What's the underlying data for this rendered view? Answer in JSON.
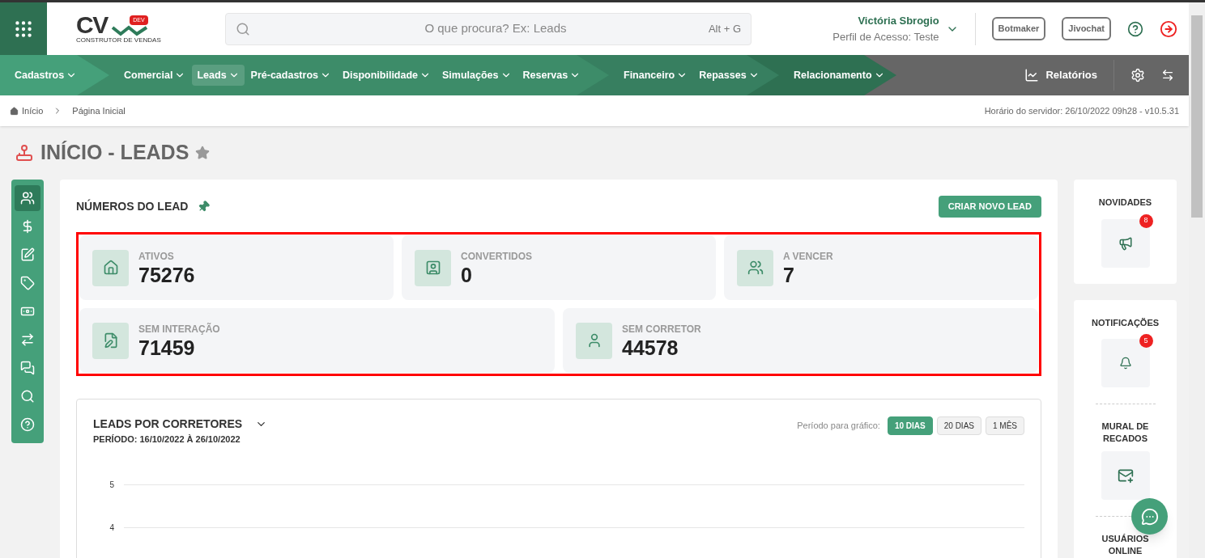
{
  "logo": {
    "letters": "CV",
    "badge": "DEV",
    "tagline": "CONSTRUTOR DE VENDAS"
  },
  "search": {
    "placeholder": "O que procura? Ex: Leads",
    "shortcut": "Alt + G"
  },
  "user": {
    "name": "Victória Sbrogio",
    "profile": "Perfil de Acesso: Teste"
  },
  "header_buttons": [
    "Botmaker",
    "Jivochat"
  ],
  "nav_groups": [
    {
      "color": "#45a07a",
      "items": [
        {
          "label": "Cadastros",
          "selected": false
        }
      ]
    },
    {
      "color": "#3d8c69",
      "items": [
        {
          "label": "Comercial",
          "selected": false
        },
        {
          "label": "Leads",
          "selected": true
        },
        {
          "label": "Pré-cadastros",
          "selected": false
        },
        {
          "label": "Disponibilidade",
          "selected": false
        },
        {
          "label": "Simulações",
          "selected": false
        },
        {
          "label": "Reservas",
          "selected": false
        }
      ]
    },
    {
      "color": "#377f60",
      "items": [
        {
          "label": "Financeiro",
          "selected": false
        },
        {
          "label": "Repasses",
          "selected": false
        }
      ]
    },
    {
      "color": "#2e7052",
      "items": [
        {
          "label": "Relacionamento",
          "selected": false
        }
      ]
    }
  ],
  "reports_label": "Relatórios",
  "breadcrumb": [
    "Início",
    "Página Inicial"
  ],
  "server_time": "Horário do servidor: 26/10/2022 09h28 - v10.5.31",
  "page_title": "INÍCIO - LEADS",
  "left_toolbar": [
    {
      "selected": true
    },
    {
      "selected": false
    },
    {
      "selected": false
    },
    {
      "selected": false
    },
    {
      "selected": false
    },
    {
      "selected": false
    },
    {
      "selected": false
    },
    {
      "selected": false
    },
    {
      "selected": false
    }
  ],
  "lead_numbers": {
    "title": "NÚMEROS DO LEAD",
    "create_button": "CRIAR NOVO LEAD",
    "stats": [
      {
        "label": "ATIVOS",
        "value": "75276"
      },
      {
        "label": "CONVERTIDOS",
        "value": "0"
      },
      {
        "label": "A VENCER",
        "value": "7"
      },
      {
        "label": "SEM INTERAÇÃO",
        "value": "71459"
      },
      {
        "label": "SEM CORRETOR",
        "value": "44578"
      }
    ]
  },
  "chart_card": {
    "title": "LEADS POR CORRETORES",
    "period": "PERÍODO: 16/10/2022 À 26/10/2022",
    "period_label": "Período para gráfico:",
    "period_buttons": [
      {
        "label": "10 DIAS",
        "selected": true
      },
      {
        "label": "20 DIAS",
        "selected": false
      },
      {
        "label": "1 MÊS",
        "selected": false
      }
    ],
    "y_axis_labels": [
      "5",
      "4"
    ]
  },
  "right_panel": {
    "news": {
      "title": "NOVIDADES",
      "count": "8"
    },
    "notifications": {
      "title": "NOTIFICAÇÕES",
      "count": "5"
    },
    "wall_title": "MURAL DE RECADOS",
    "online_title": "USUÁRIOS ONLINE"
  }
}
